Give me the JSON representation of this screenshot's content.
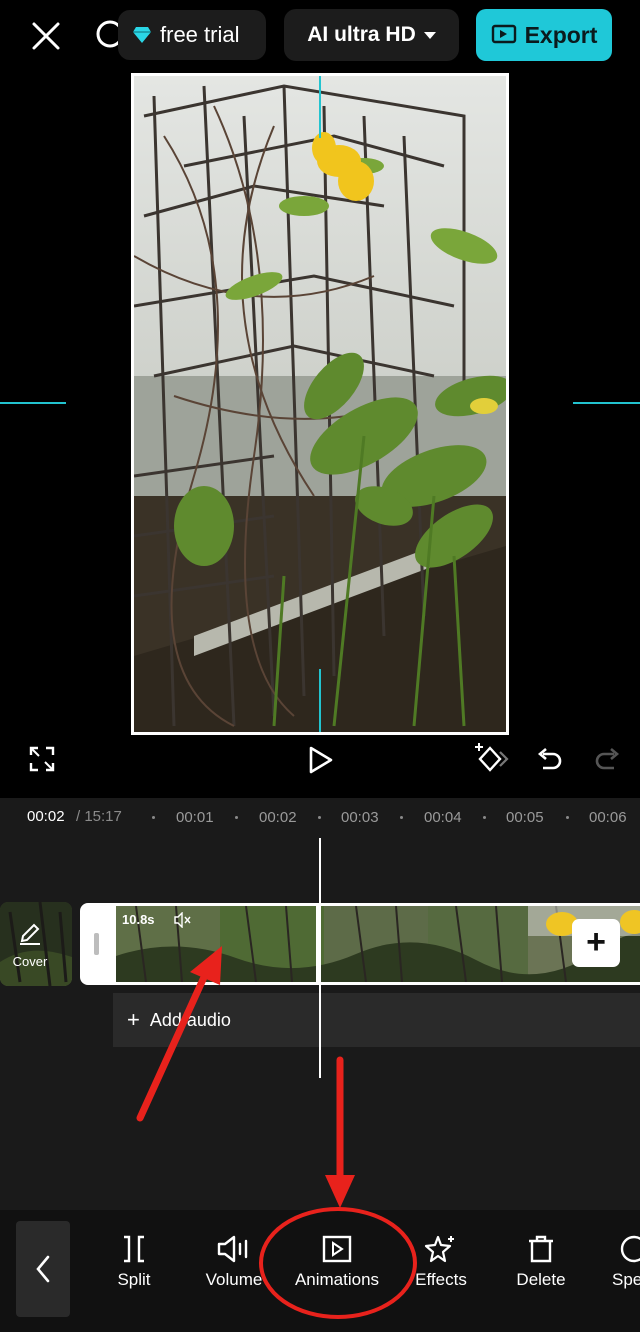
{
  "header": {
    "free_trial_label": "free trial",
    "quality_label": "AI ultra HD",
    "export_label": "Export"
  },
  "icons": {
    "close": "close-icon",
    "search": "search-icon",
    "diamond": "diamond-icon",
    "export": "export-icon",
    "fullscreen": "fullscreen-icon",
    "play": "play-icon",
    "keyframe": "keyframe-icon",
    "undo": "undo-icon",
    "redo": "redo-icon"
  },
  "colors": {
    "accent": "#1fc8d8",
    "annotation_red": "#e8221c"
  },
  "timeline": {
    "current_time": "00:02",
    "total_time": "/ 15:17",
    "ticks": [
      "00:01",
      "00:02",
      "00:03",
      "00:04",
      "00:05",
      "00:06"
    ],
    "cover_label": "Cover",
    "clip_duration": "10.8s",
    "add_audio_label": "Add audio"
  },
  "toolbar": {
    "items": [
      {
        "label": "Split",
        "icon": "split-icon"
      },
      {
        "label": "Volume",
        "icon": "volume-icon"
      },
      {
        "label": "Animations",
        "icon": "animations-icon"
      },
      {
        "label": "Effects",
        "icon": "effects-icon"
      },
      {
        "label": "Delete",
        "icon": "delete-icon"
      },
      {
        "label": "Spe",
        "icon": "speed-icon"
      }
    ]
  }
}
